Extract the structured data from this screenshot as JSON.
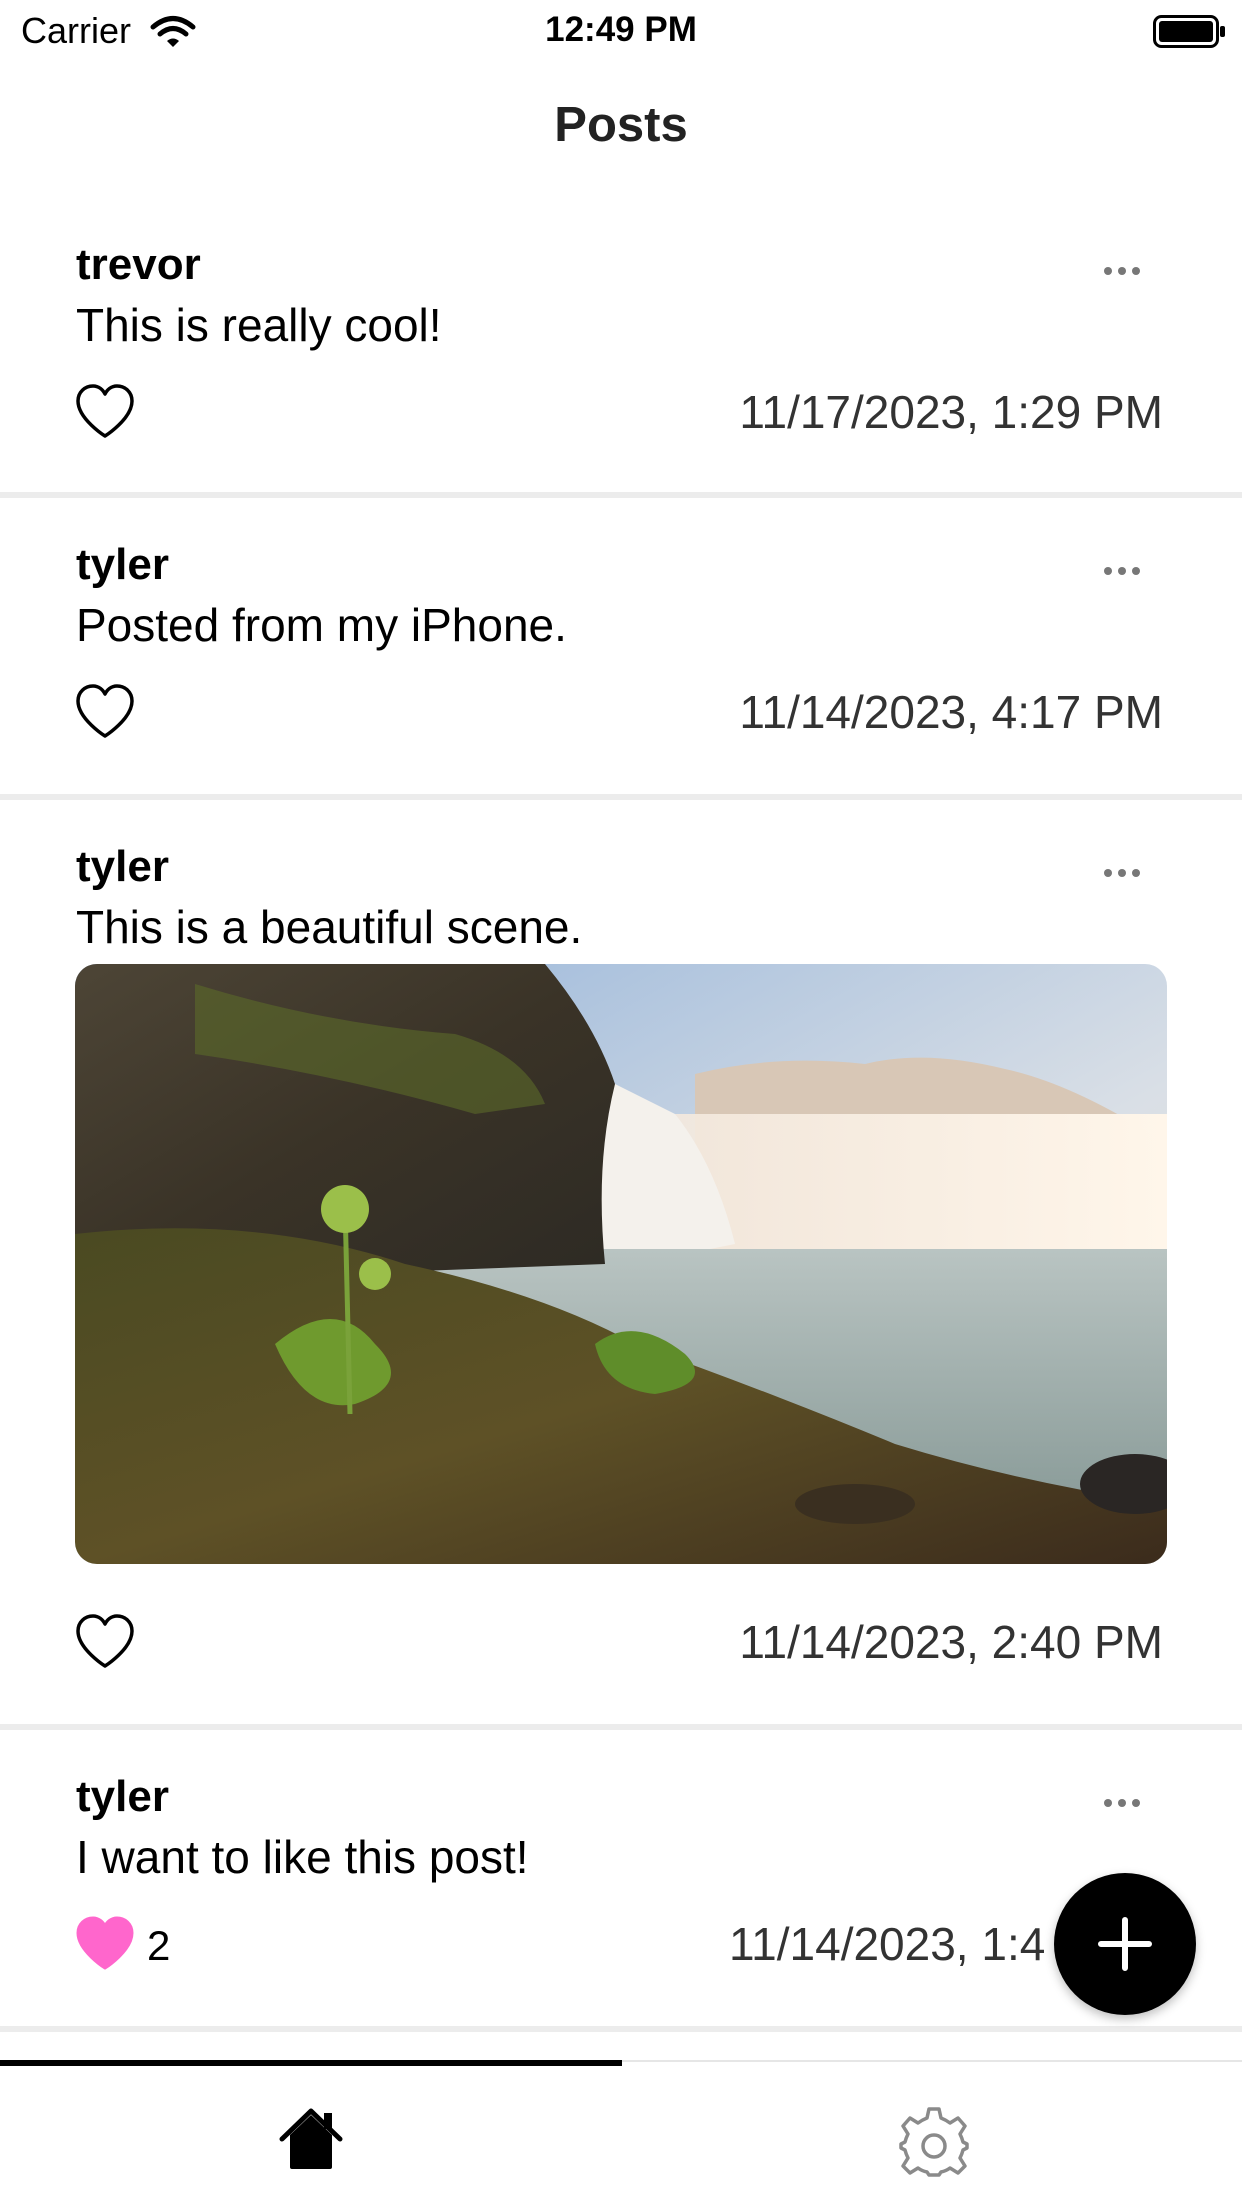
{
  "status_bar": {
    "carrier": "Carrier",
    "time": "12:49 PM"
  },
  "header": {
    "title": "Posts"
  },
  "posts": [
    {
      "author": "trevor",
      "text": "This is really cool!",
      "timestamp": "11/17/2023, 1:29 PM",
      "liked": false,
      "has_image": false
    },
    {
      "author": "tyler",
      "text": "Posted from my iPhone.",
      "timestamp": "11/14/2023, 4:17 PM",
      "liked": false,
      "has_image": false
    },
    {
      "author": "tyler",
      "text": "This is a beautiful scene.",
      "timestamp": "11/14/2023, 2:40 PM",
      "liked": false,
      "has_image": true
    },
    {
      "author": "tyler",
      "text": "I want to like this post!",
      "timestamp": "11/14/2023, 1:4",
      "liked": true,
      "like_count": "2",
      "has_image": false
    }
  ],
  "tabs": [
    {
      "icon": "home-icon",
      "selected": true
    },
    {
      "icon": "gear-icon",
      "selected": false
    }
  ],
  "colors": {
    "liked_heart": "#ff66cc",
    "accent": "#000000",
    "divider": "#ececec"
  }
}
